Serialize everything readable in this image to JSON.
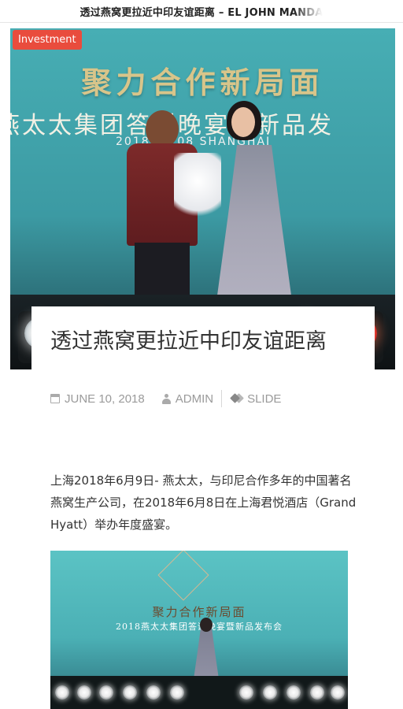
{
  "header": {
    "title": "透过燕窝更拉近中印友谊距离 – EL JOHN MANDA"
  },
  "hero": {
    "category_badge": "Investment",
    "screen_line1": "聚力合作新局面",
    "screen_line2": "燕太太集团答谢晚宴暨新品发",
    "screen_line3": "2018.06.08 SHANGHAI"
  },
  "post": {
    "title": "透过燕窝更拉近中印友谊距离",
    "meta": {
      "date": "JUNE 10, 2018",
      "author": "ADMIN",
      "category": "SLIDE"
    },
    "paragraph": "上海2018年6月9日- 燕太太，与印尼合作多年的中国著名燕窝生产公司，在2018年6月8日在上海君悦酒店（Grand Hyatt）举办年度盛宴。"
  },
  "image2": {
    "line1": "聚力合作新局面",
    "line2": "2018燕太太集团答谢晚宴暨新品发布会"
  },
  "icons": {
    "date": "calendar-icon",
    "author": "user-icon",
    "category": "tags-icon"
  },
  "colors": {
    "badge": "#e94c3d",
    "meta_text": "#9a9a9a",
    "hero_background": "#47aeb4"
  }
}
